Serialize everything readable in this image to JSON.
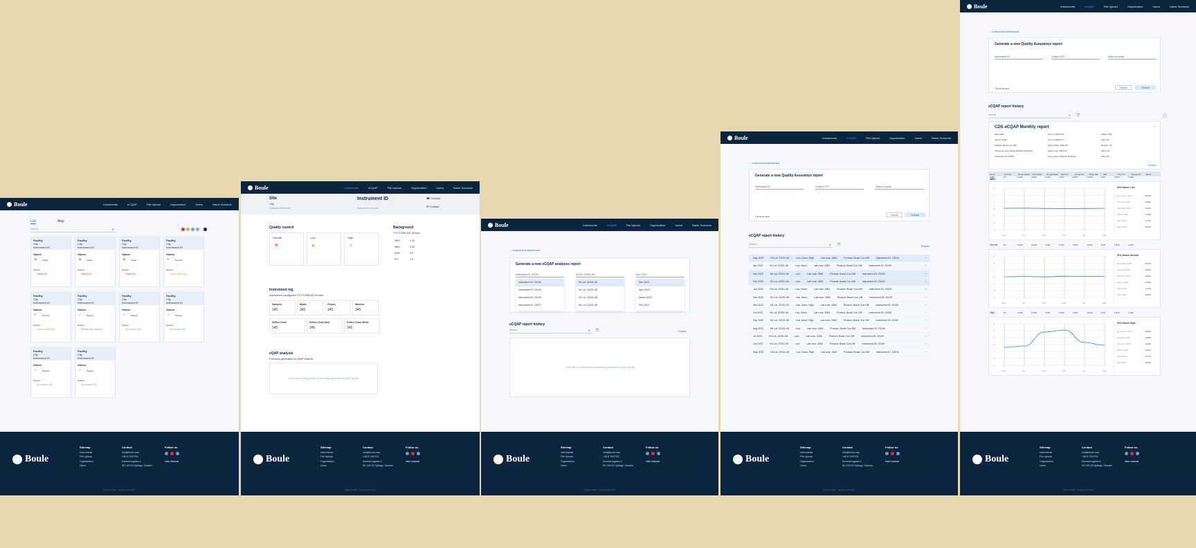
{
  "nav": {
    "logo": "Boule",
    "items": [
      "Instruments",
      "eCQAP",
      "File Upload",
      "Organization",
      "Users",
      "Name Surname"
    ]
  },
  "footer": {
    "logo": "Boule",
    "sitemap_title": "Sitemap",
    "sitemap": [
      "Instruments",
      "File Upload",
      "Organization",
      "Users"
    ],
    "contact_title": "Contact",
    "contact": [
      "info@boule.com",
      "+46 8 7447700",
      "",
      "Domnarvsgatan 4",
      "SE-163 53 Spånga, Sweden"
    ],
    "follow_title": "Follow us",
    "user_manual": "User manual",
    "copyright": "© Boule 2023 · Cookies & Privacy"
  },
  "panel1": {
    "tabs": [
      "List",
      "Map"
    ],
    "search_placeholder": "Search",
    "cards": [
      {
        "facility": "Facility",
        "city": "City",
        "instrument": "Instrument ID",
        "status_label": "Status",
        "status": "Failed",
        "notes_label": "Notices",
        "note": "Failed QC"
      },
      {
        "facility": "Facility",
        "city": "City",
        "instrument": "Instrument ID",
        "status_label": "Status",
        "status": "Failed",
        "notes_label": "Notices",
        "note": "Failed QC"
      },
      {
        "facility": "Facility",
        "city": "City",
        "instrument": "Instrument ID",
        "status_label": "Status",
        "status": "Failed",
        "notes_label": "Notices",
        "note": "Failed QC"
      },
      {
        "facility": "Facility",
        "city": "City",
        "instrument": "Instrument ID",
        "status_label": "Status",
        "status": "Pending",
        "notes_label": "Notices",
        "note": "Check with flags"
      },
      {
        "facility": "Facility",
        "city": "City",
        "instrument": "Instrument ID",
        "status_label": "Status",
        "status": "Pending",
        "notes_label": "Notices",
        "note": "Passed with flags"
      },
      {
        "facility": "Facility",
        "city": "City",
        "instrument": "Instrument ID",
        "status_label": "Status",
        "status": "Passed",
        "notes_label": "Notices",
        "note": "Results are missing"
      },
      {
        "facility": "Facility",
        "city": "City",
        "instrument": "Instrument ID",
        "status_label": "Status",
        "status": "Passed",
        "notes_label": "Notices",
        "note": "Successful QC"
      },
      {
        "facility": "Facility",
        "city": "City",
        "instrument": "Instrument ID",
        "status_label": "Status",
        "status": "Passed",
        "notes_label": "Notices",
        "note": "Successful QC"
      },
      {
        "facility": "Facility",
        "city": "City",
        "instrument": "Instrument ID",
        "status_label": "Status",
        "status": "Passed",
        "notes_label": "Notices",
        "note": "Successful QC"
      },
      {
        "facility": "Facility",
        "city": "City",
        "instrument": "Instrument ID",
        "status_label": "Status",
        "status": "Passed",
        "notes_label": "Notices",
        "note": "Successful QC"
      }
    ]
  },
  "panel2": {
    "site": "Site",
    "city": "City",
    "address": "Statistic Address",
    "instrument_title": "Instrument ID",
    "instrument_sub": "Instrument model",
    "contact1": "Contact",
    "contact2": "Contact",
    "qc_title": "Quality control",
    "qc_levels": [
      "Normal",
      "Low",
      "High"
    ],
    "background_title": "Background",
    "background_sub": "YYYY-MM-DD 00:mm",
    "bg_rows": [
      [
        "WBC",
        "0.00"
      ],
      [
        "WBC",
        "0.00"
      ],
      [
        "HGB",
        "0.0"
      ],
      [
        "PLT",
        "0.0"
      ]
    ],
    "log_title": "Instrument log",
    "log_sub": "Instrument configured YYYY-MM-DD hh:mm",
    "log_stats": [
      [
        "Samples",
        "345"
      ],
      [
        "Blank",
        "345"
      ],
      [
        "Primes",
        "345"
      ],
      [
        "Washes",
        "345"
      ],
      [
        "Diff/cs Clean",
        "345"
      ],
      [
        "Diff/cs Clean Mod",
        "345"
      ],
      [
        "Diff/cs Clean White",
        "345"
      ]
    ],
    "ecqap_title": "eQAP analysis",
    "ecqap_sub": "Previous generated eCQAP reports",
    "ecqap_empty": "There is no history stored of previously generated eCQAP reports"
  },
  "panel3": {
    "back": "← Instrument dashboard",
    "gen_title": "Generate a new eCQAP analyses report",
    "select1": "Instrument ID: 23109",
    "select2": "Kit Lot: 22201-08",
    "select3": "Mar 2023",
    "list1": [
      "Instrument ID: 23109",
      "Instrument ID: 23109",
      "Instrument ID: 23105",
      "Instrument ID: 23572"
    ],
    "list2": [
      "Kit Lot: 22201-08",
      "Kit Lot: 22201-08",
      "Kit Lot: 22201-08",
      "Kit Lot: 22201-08"
    ],
    "list3": [
      "Mar 2023",
      "April 2023",
      "March 2023",
      "Feb 2023"
    ],
    "history_title": "eCQAP report history",
    "search_placeholder": "Search",
    "export": "Export",
    "empty": "There are no documents or previously generated eCQAP reports"
  },
  "panel4": {
    "back": "← Instrument dashboard",
    "gen_title": "Generate a new Quality Assurance report",
    "select1": "Instrument ID*",
    "select2": "Control LOT*",
    "select3": "Select a month",
    "required": "* Required field",
    "cancel": "Cancel",
    "submit": "Submit",
    "history_title": "eCQAP report history",
    "search_placeholder": "Search",
    "export": "Export",
    "rows": [
      {
        "month": "May 2023",
        "lot": "Kit Lot: 22201-08",
        "level": "Low, Norm, High",
        "runs": "Lab runs: 3360",
        "product": "Product: Boule Con Diff",
        "inst": "Instrument ID: 23109"
      },
      {
        "month": "Apr 2023",
        "lot": "Kit Lot: 22201-08",
        "level": "Low, Norm",
        "runs": "Lab runs: 3360",
        "product": "Product: Boule Con Diff",
        "inst": "Instrument ID: 23109"
      },
      {
        "month": "Mar 2023",
        "lot": "Kit Lot: 22201-08",
        "level": "Low",
        "runs": "Lab runs: 3360",
        "product": "Product: Boule Con Diff",
        "inst": "Instrument ID: 23109"
      },
      {
        "month": "Feb 2023",
        "lot": "Kit Lot: 22201-08",
        "level": "Low",
        "runs": "Lab runs: 3360",
        "product": "Product: Boule Con Diff",
        "inst": "Instrument ID: 23109"
      },
      {
        "month": "Jan 2023",
        "lot": "Kit Lot: 22201-08",
        "level": "Low, Norm",
        "runs": "Lab runs: 3360",
        "product": "Product: Boule Con Diff",
        "inst": "Instrument ID: 23109"
      },
      {
        "month": "Dec 2022",
        "lot": "Kit Lot: 22201-08",
        "level": "Low, Norm",
        "runs": "Lab runs: 3360",
        "product": "Product: Boule Con Diff",
        "inst": "Instrument ID: 23109"
      },
      {
        "month": "Nov 2022",
        "lot": "Kit Lot: 22201-08",
        "level": "Low, Norm, High",
        "runs": "Lab runs: 3360",
        "product": "Product: Boule Con Diff",
        "inst": "Instrument ID: 23109"
      },
      {
        "month": "Oct 2022",
        "lot": "Kit Lot: 22201-08",
        "level": "Low, Norm",
        "runs": "Lab runs: 3360",
        "product": "Product: Boule Con Diff",
        "inst": "Instrument ID: 23109"
      },
      {
        "month": "Sep 2022",
        "lot": "Kit Lot: 22201-08",
        "level": "Low, Norm, High",
        "runs": "Lab runs: 3360",
        "product": "Product: Boule Con Diff",
        "inst": "Instrument ID: 23109"
      },
      {
        "month": "Aug 2022",
        "lot": "Kit Lot: 22201-08",
        "level": "Low",
        "runs": "Lab runs: 3360",
        "product": "Product: Boule Con Diff",
        "inst": "Instrument ID: 23109"
      },
      {
        "month": "Jul 2022",
        "lot": "Kit Lot: 22201-08",
        "level": "Low",
        "runs": "Lab runs: 3360",
        "product": "Product: Boule Con Diff",
        "inst": "Instrument ID: 23109"
      },
      {
        "month": "Jun 2022",
        "lot": "Kit Lot: 22201-08",
        "level": "Low",
        "runs": "Lab runs: 3360",
        "product": "Product: Boule Con Diff",
        "inst": "Instrument ID: 23109"
      },
      {
        "month": "May 2022",
        "lot": "Kit Lot: 22201-08",
        "level": "Low, Norm, High",
        "runs": "Lab runs: 3360",
        "product": "Product: Boule Con Diff",
        "inst": "Instrument ID: 23109"
      }
    ]
  },
  "panel5": {
    "back": "← Instrument dashboard",
    "gen_title": "Generate a new Quality Assurance report",
    "select1": "Instrument ID*",
    "select2": "Control LOT*",
    "select3": "Select a month",
    "required": "* Required field",
    "cancel": "Cancel",
    "submit": "Submit",
    "history_title": "eCQAP report history",
    "search_placeholder": "Search",
    "report_title": "CDS eCQAP Monthly report",
    "report_meta": [
      "May 2023",
      "Lab ID: 2398",
      "Product: Boule Con Diff",
      "Instrument type: Boule Medonic M-Series",
      "Instrument ID: 23109"
    ],
    "report_meta2": [
      "Kit Lot: 22201-08",
      "Kit Lot: 22201-01",
      "Expiry Date: 2023-08",
      "Expiry Low: 2023-10",
      "Peer group: Medonic M Series"
    ],
    "report_meta3": [
      "Status: blks",
      "Sent: 1/2",
      "Review: 1/1",
      "Sent: 1/2",
      "Sent: 1/2"
    ],
    "export": "Export",
    "table_headers": [
      "Level",
      "Your No.",
      "Group Mean",
      "Your Mean",
      "Group Mode",
      "Your CV",
      "Group CV",
      "Mean Diff",
      "SDI",
      "Your Cv",
      "Group Cv",
      "Sdrat"
    ],
    "param": "WBC",
    "chart_rows": [
      {
        "level": "Low",
        "values": [
          "10",
          "2.216",
          "2.246",
          "2.115",
          "2.157",
          "0.607",
          "-0.015",
          "-0.44",
          "1.870",
          "1.393"
        ]
      },
      {
        "level": "Normal",
        "values": [
          "10",
          "2.216",
          "2.246",
          "2.115",
          "2.157",
          "0.607",
          "-0.015",
          "-0.44",
          "1.870",
          "1.393"
        ]
      },
      {
        "level": "High",
        "values": [
          "10",
          "2.216",
          "2.246",
          "2.115",
          "2.157",
          "0.607",
          "-0.015",
          "-0.44",
          "1.870",
          "1.393"
        ]
      }
    ],
    "sdi_titles": [
      "SDI Values Low",
      "SDI Values Normal",
      "SDI Values High"
    ],
    "sdi_rows": [
      [
        "December 2022",
        "January 2023",
        "February 2023",
        "March 2023",
        "April 2023",
        "May 2023"
      ],
      [
        "December 2022",
        "January 2023",
        "February 2023",
        "March 2023",
        "April 2023",
        "May 2023"
      ],
      [
        "December 2022",
        "January 2023",
        "February 2023",
        "March 2023",
        "April 2023",
        "May 2023"
      ]
    ],
    "sdi_values": [
      "-0.015",
      "-0.083",
      "-0.220",
      "-0.460",
      "-0.720",
      "-0.090"
    ],
    "x_ticks": [
      "Dec",
      "Jan",
      "Feb",
      "Mar",
      "Apr",
      "May"
    ],
    "y_ticks": [
      "3",
      "2",
      "1",
      "0",
      "-1",
      "-2",
      "-3"
    ]
  }
}
